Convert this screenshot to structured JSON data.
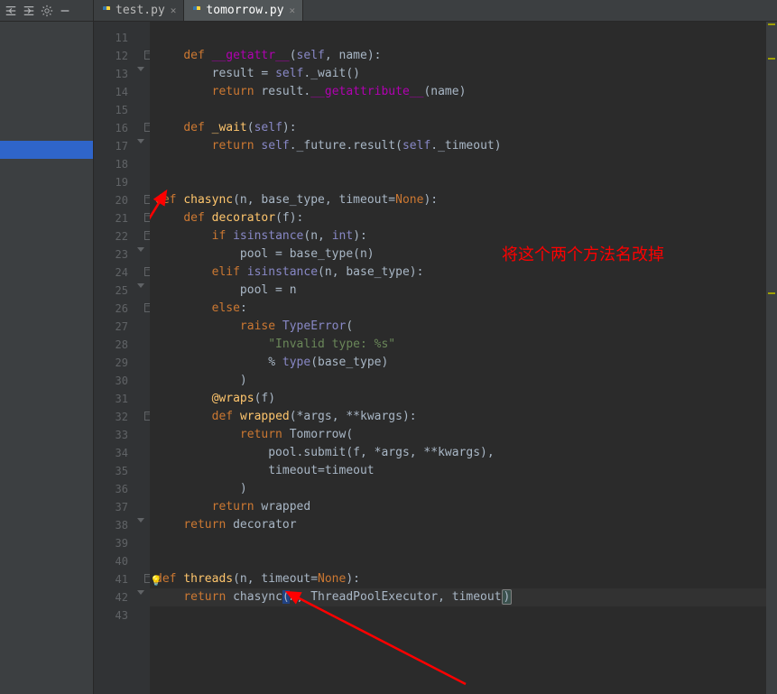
{
  "toolbar": {
    "icons": [
      "indent-left-icon",
      "indent-right-icon",
      "gear-icon",
      "minimize-icon"
    ]
  },
  "tabs": [
    {
      "label": "test.py",
      "active": false
    },
    {
      "label": "tomorrow.py",
      "active": true
    }
  ],
  "annotation": "将这个两个方法名改掉",
  "gutter": {
    "start": 11,
    "end": 43
  },
  "code": [
    {
      "n": 11,
      "html": ""
    },
    {
      "n": 12,
      "html": "    <span class='k'>def </span><span class='mag'>__getattr__</span><span class='p'>(</span><span class='bi'>self</span><span class='p'>, name):</span>"
    },
    {
      "n": 13,
      "html": "        <span class='p'>result = </span><span class='bi'>self</span><span class='p'>._wait()</span>"
    },
    {
      "n": 14,
      "html": "        <span class='k'>return </span><span class='p'>result.</span><span class='mag'>__getattribute__</span><span class='p'>(name)</span>"
    },
    {
      "n": 15,
      "html": ""
    },
    {
      "n": 16,
      "html": "    <span class='k'>def </span><span class='fn'>_wait</span><span class='p'>(</span><span class='bi'>self</span><span class='p'>):</span>"
    },
    {
      "n": 17,
      "html": "        <span class='k'>return </span><span class='bi'>self</span><span class='p'>._future.result(</span><span class='bi'>self</span><span class='p'>._timeout)</span>"
    },
    {
      "n": 18,
      "html": ""
    },
    {
      "n": 19,
      "html": ""
    },
    {
      "n": 20,
      "html": "<span class='k'>def </span><span class='fn'>chasync</span><span class='p'>(n, base_type, timeout=</span><span class='k'>None</span><span class='p'>):</span>"
    },
    {
      "n": 21,
      "html": "    <span class='k'>def </span><span class='fn'>decorator</span><span class='p'>(f):</span>"
    },
    {
      "n": 22,
      "html": "        <span class='k'>if </span><span class='bi'>isinstance</span><span class='p'>(n, </span><span class='bi'>int</span><span class='p'>):</span>"
    },
    {
      "n": 23,
      "html": "            <span class='p'>pool = base_type(n)</span>"
    },
    {
      "n": 24,
      "html": "        <span class='k'>elif </span><span class='bi'>isinstance</span><span class='p'>(n, base_type):</span>"
    },
    {
      "n": 25,
      "html": "            <span class='p'>pool = n</span>"
    },
    {
      "n": 26,
      "html": "        <span class='k'>else</span><span class='p'>:</span>"
    },
    {
      "n": 27,
      "html": "            <span class='k'>raise </span><span class='bi'>TypeError</span><span class='p'>(</span>"
    },
    {
      "n": 28,
      "html": "                <span class='s'>\"Invalid type: %s\"</span>"
    },
    {
      "n": 29,
      "html": "                <span class='p'>% </span><span class='bi'>type</span><span class='p'>(base_type)</span>"
    },
    {
      "n": 30,
      "html": "            <span class='p'>)</span>"
    },
    {
      "n": 31,
      "html": "        <span class='fn'>@wraps</span><span class='p'>(f)</span>"
    },
    {
      "n": 32,
      "html": "        <span class='k'>def </span><span class='fn'>wrapped</span><span class='p'>(*args, **kwargs):</span>"
    },
    {
      "n": 33,
      "html": "            <span class='k'>return </span><span class='p'>Tomorrow(</span>"
    },
    {
      "n": 34,
      "html": "                <span class='p'>pool.submit(f, *args, **kwargs),</span>"
    },
    {
      "n": 35,
      "html": "                <span class='p'>timeout=timeout</span>"
    },
    {
      "n": 36,
      "html": "            <span class='p'>)</span>"
    },
    {
      "n": 37,
      "html": "        <span class='k'>return </span><span class='p'>wrapped</span>"
    },
    {
      "n": 38,
      "html": "    <span class='k'>return </span><span class='p'>decorator</span>"
    },
    {
      "n": 39,
      "html": ""
    },
    {
      "n": 40,
      "html": ""
    },
    {
      "n": 41,
      "html": "<span class='k'>def </span><span class='fn'>threads</span><span class='p'>(n, timeout=</span><span class='k'>None</span><span class='p'>):</span>"
    },
    {
      "n": 42,
      "html": "    <span class='k'>return </span><span class='p'>chasync</span><span class='hl'>(</span><span class='p'>n, ThreadPoolExecutor, timeout</span><span class='hl2'>)</span>",
      "current": true
    },
    {
      "n": 43,
      "html": ""
    }
  ],
  "folds": {
    "12": "open",
    "13": "close-arrow",
    "16": "open",
    "17": "close-arrow",
    "20": "open",
    "21": "open",
    "22": "open",
    "23": "close-arrow",
    "24": "open",
    "25": "close-arrow",
    "26": "open",
    "32": "open",
    "38": "close-arrow",
    "41": "open",
    "42": "close-arrow"
  }
}
